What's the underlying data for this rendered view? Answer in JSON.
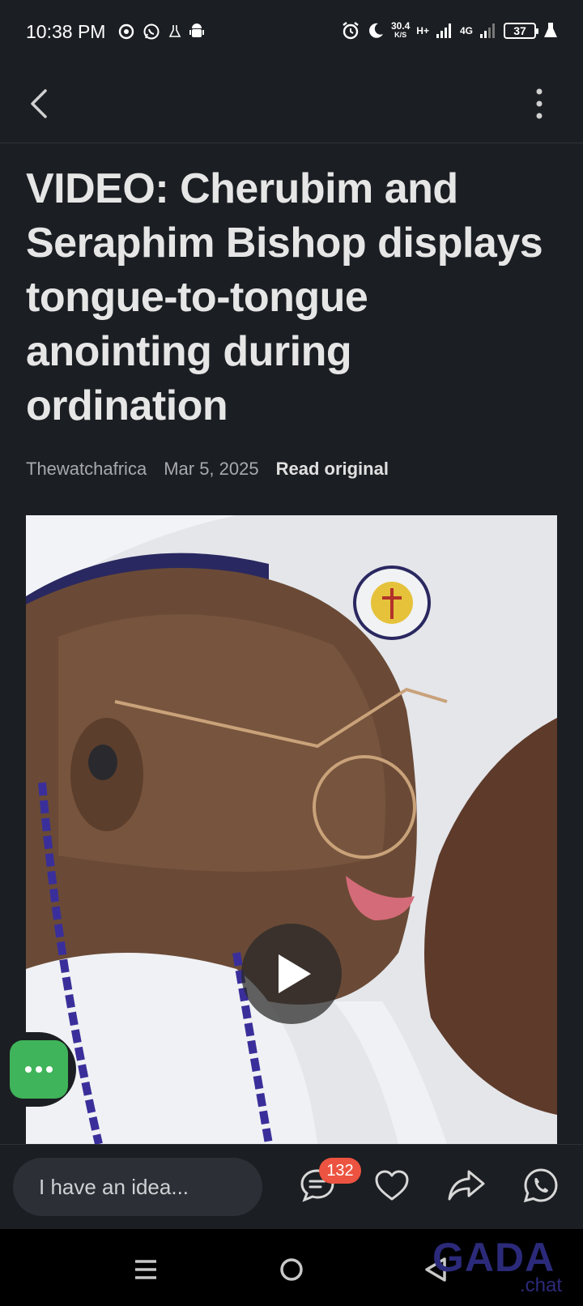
{
  "status_bar": {
    "time": "10:38 PM",
    "speed_value": "30.4",
    "speed_unit": "K/S",
    "network_1": "H+",
    "network_2": "4G",
    "battery": "37",
    "left_icons": [
      "chrome-icon",
      "whatsapp-icon",
      "flask-icon",
      "android-icon"
    ],
    "right_icons": [
      "alarm-icon",
      "moon-icon",
      "signal-icon",
      "flask-icon"
    ]
  },
  "article": {
    "title": "VIDEO: Cherubim and Seraphim Bishop displays tongue-to-tongue anointing during ordination",
    "source": "Thewatchafrica",
    "date": "Mar 5, 2025",
    "read_original": "Read original"
  },
  "bottom_bar": {
    "input_placeholder": "I have an idea...",
    "comment_count": "132"
  },
  "watermark": {
    "brand": "GADA",
    "suffix": ".chat"
  },
  "colors": {
    "background": "#1b1e22",
    "fab": "#3fb45a",
    "badge": "#ec5340",
    "watermark": "#2b2a7a"
  }
}
